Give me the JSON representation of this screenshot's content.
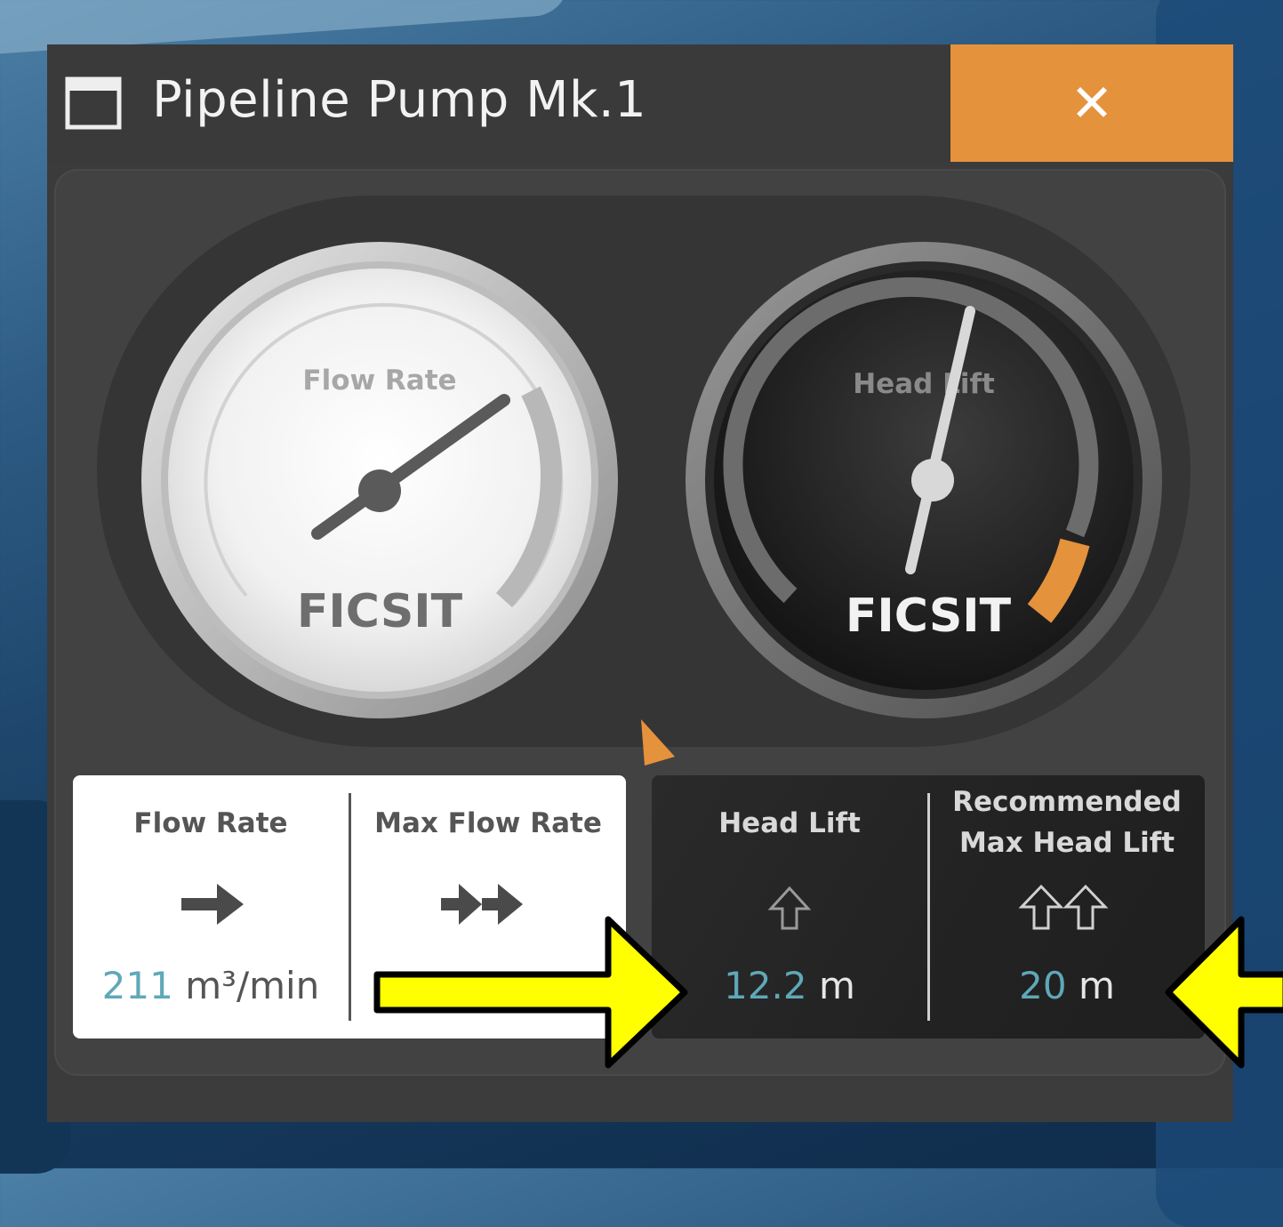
{
  "window": {
    "title": "Pipeline Pump Mk.1",
    "close_glyph": "✕",
    "accent_color": "#e5923c"
  },
  "gauges": {
    "flow_rate": {
      "label": "Flow Rate",
      "brand": "FICSIT",
      "needle_fraction": 0.62
    },
    "head_lift": {
      "label": "Head Lift",
      "brand": "FICSIT",
      "needle_fraction": 0.61,
      "recommended_fraction": 0.95
    }
  },
  "stats": {
    "flow_rate": {
      "label": "Flow Rate",
      "icon": "arrow-right-icon",
      "value": "211",
      "unit": "m³/min"
    },
    "max_flow_rate": {
      "label": "Max Flow Rate",
      "icon": "double-arrow-right-icon",
      "value": "",
      "unit": ""
    },
    "head_lift": {
      "label": "Head Lift",
      "icon": "arrow-up-icon",
      "value": "12.2",
      "unit": "m"
    },
    "recommended_max_head_lift": {
      "label_line1": "Recommended",
      "label_line2": "Max Head Lift",
      "icon": "double-arrow-up-icon",
      "value": "20",
      "unit": "m"
    }
  },
  "annotation_color": "#ffff00"
}
